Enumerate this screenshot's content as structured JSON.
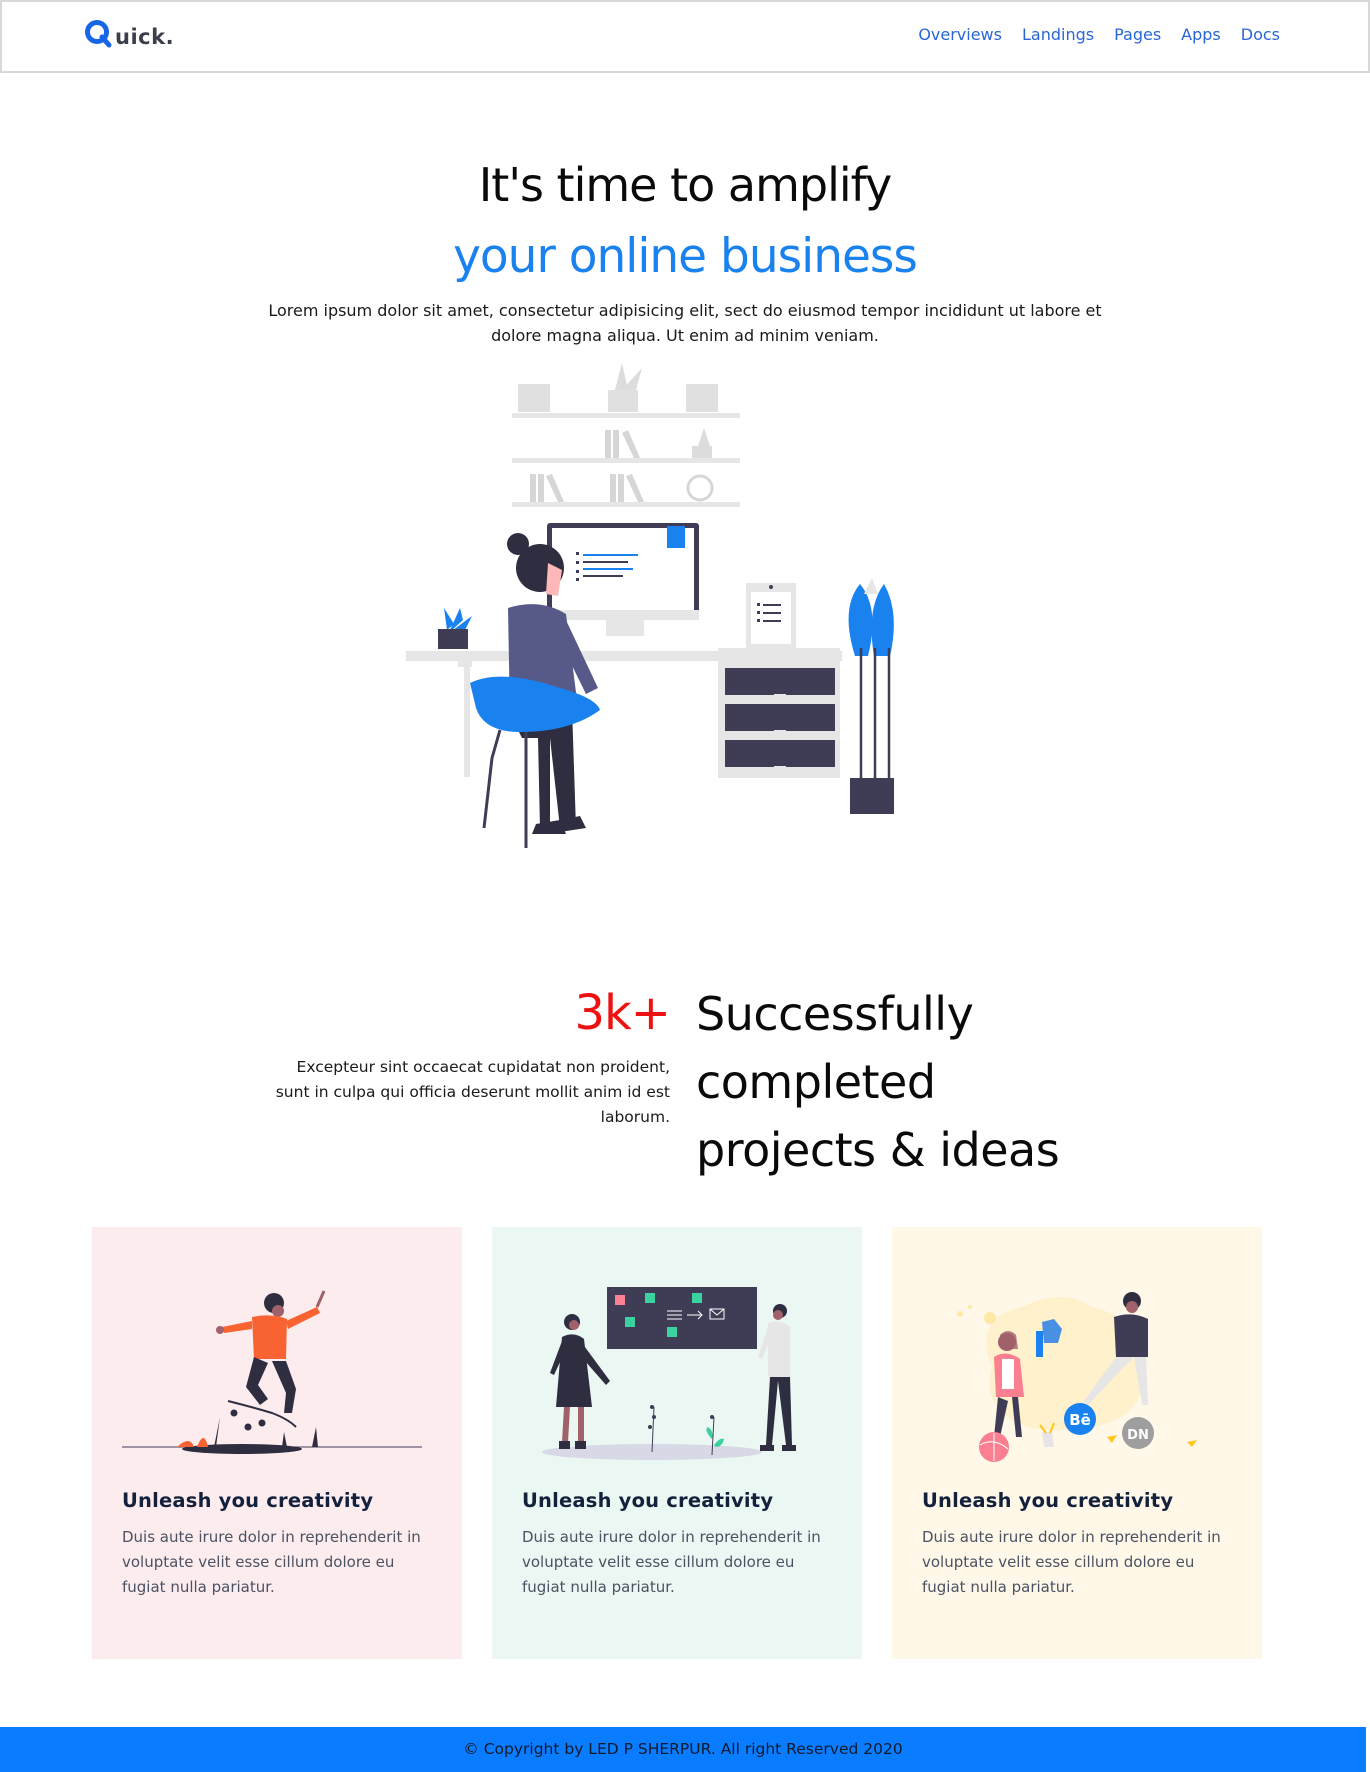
{
  "nav": {
    "logo_text": "uick.",
    "links": [
      "Overviews",
      "Landings",
      "Pages",
      "Apps",
      "Docs"
    ]
  },
  "hero": {
    "line1": "It's time to amplify",
    "line2": "your online business",
    "paragraph": "Lorem ipsum dolor sit amet, consectetur adipisicing elit, sect do eiusmod tempor incididunt ut labore et dolore magna aliqua. Ut enim ad minim veniam."
  },
  "stats": {
    "number": "3k+",
    "description": "Excepteur sint occaecat cupidatat non proident, sunt in culpa qui officia deserunt mollit anim id est laborum.",
    "heading_line1": "Successfully",
    "heading_line2": "completed",
    "heading_line3": "projects & ideas"
  },
  "cards": [
    {
      "title": "Unleash you creativity",
      "body": "Duis aute irure dolor in reprehenderit in voluptate velit esse cillum dolore eu fugiat nulla pariatur."
    },
    {
      "title": "Unleash you creativity",
      "body": "Duis aute irure dolor in reprehenderit in voluptate velit esse cillum dolore eu fugiat nulla pariatur."
    },
    {
      "title": "Unleash you creativity",
      "body": "Duis aute irure dolor in reprehenderit in voluptate velit esse cillum dolore eu fugiat nulla pariatur."
    }
  ],
  "card_badges": {
    "behance": "Bē",
    "dn": "DN"
  },
  "footer": {
    "copyright": "© Copyright by LED P SHERPUR. All right Reserved 2020"
  },
  "colors": {
    "accent_blue": "#1a82ee",
    "stat_red": "#ee1111",
    "footer_bg": "#0a7cff",
    "card_pink": "#fdecee",
    "card_mint": "#eaf7f2",
    "card_cream": "#fff8e9"
  }
}
